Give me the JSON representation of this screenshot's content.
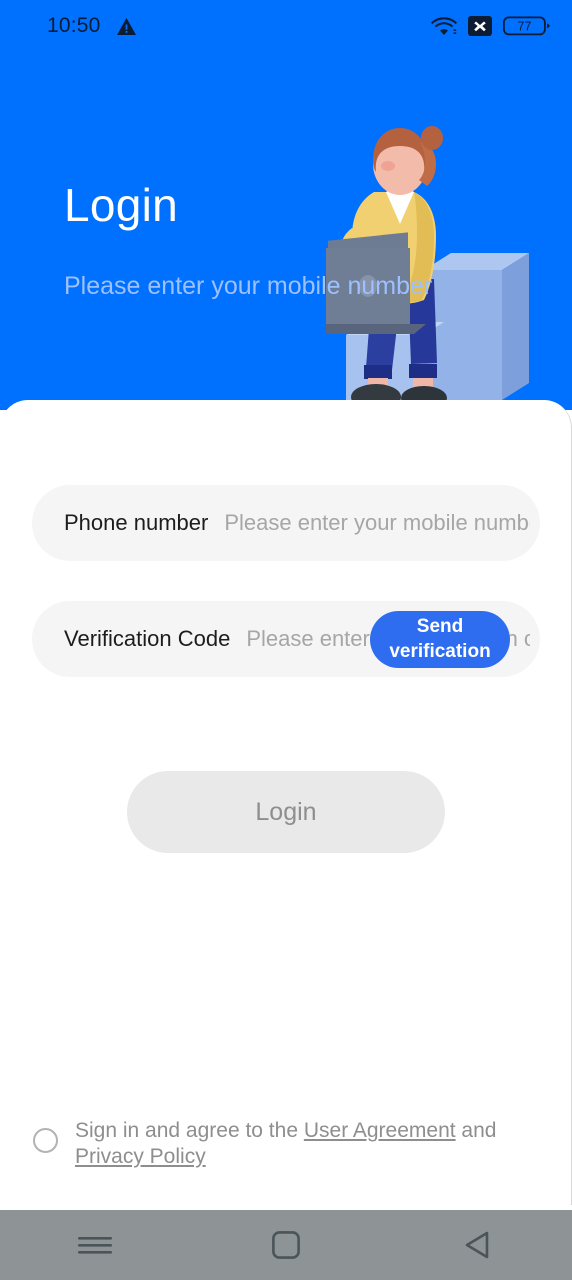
{
  "statusbar": {
    "time": "10:50",
    "warning_icon": "warning-triangle-icon",
    "wifi_icon": "wifi-icon",
    "x_badge_icon": "x-badge-icon",
    "battery_icon": "battery-icon",
    "battery_level": "77"
  },
  "header": {
    "title": "Login",
    "subtitle": "Please enter your mobile number",
    "background_color": "#0070ff",
    "title_color": "#ffffff",
    "subtitle_color": "#9dc1ff",
    "illustration": "woman-with-laptop-illustration"
  },
  "form": {
    "phone": {
      "label": "Phone number",
      "value": "",
      "placeholder": "Please enter your mobile number"
    },
    "code": {
      "label": "Verification Code",
      "value": "",
      "placeholder": "Please enter the verification code",
      "send_button_label": "Send verification code",
      "send_button_color": "#2f6df0"
    },
    "login_button": {
      "label": "Login",
      "background_color": "#e9e9e9",
      "text_color": "#8e8e8e"
    }
  },
  "agreement": {
    "checked": false,
    "prefix": "Sign in and agree to the ",
    "user_agreement": "User Agreement",
    "middle": " and ",
    "privacy_policy": "Privacy Policy"
  },
  "navbar": {
    "recents_icon": "menu-icon",
    "home_icon": "home-square-icon",
    "back_icon": "back-triangle-icon",
    "background_color": "#8e9496"
  }
}
